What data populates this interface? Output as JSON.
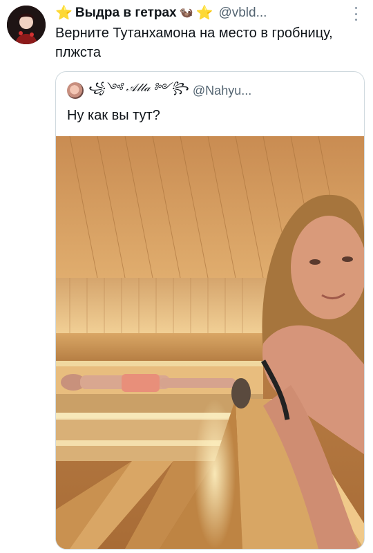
{
  "tweet": {
    "star_left": "⭐",
    "display_name": "Выдра в гетрах",
    "emoji": "🦦",
    "star_right": "⭐",
    "handle": "@vbld...",
    "text": "Верните Тутанхамона на место в гробницу, плжста",
    "icons": {
      "avatar": "avatar-icon",
      "more": "more-icon"
    }
  },
  "quote": {
    "display_name": "꧁༺ 𝒜𝓁𝓁𝒶 ༻꧂",
    "handle": "@Nahyu...",
    "text": "Ну как вы тут?",
    "icons": {
      "avatar": "avatar-icon"
    }
  },
  "colors": {
    "handle": "#536471",
    "border": "#cfd9de",
    "star": "#f5b800"
  }
}
